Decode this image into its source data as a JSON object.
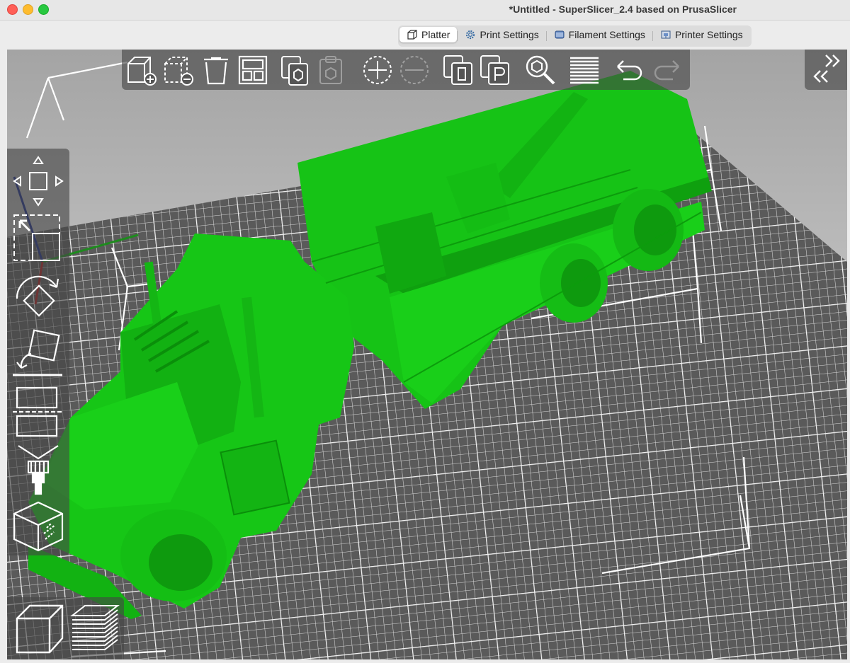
{
  "window": {
    "title": "*Untitled - SuperSlicer_2.4  based on PrusaSlicer"
  },
  "tabs": [
    {
      "label": "Platter",
      "icon": "platter-icon",
      "active": true
    },
    {
      "label": "Print Settings",
      "icon": "gear-icon",
      "active": false
    },
    {
      "label": "Filament Settings",
      "icon": "filament-spool-icon",
      "active": false
    },
    {
      "label": "Printer Settings",
      "icon": "printer-icon",
      "active": false
    }
  ],
  "toolbar": [
    {
      "name": "add-object-button",
      "icon": "cube-plus-icon",
      "enabled": true
    },
    {
      "name": "delete-object-button",
      "icon": "cube-minus-icon",
      "enabled": true
    },
    {
      "name": "delete-all-button",
      "icon": "trash-icon",
      "enabled": true
    },
    {
      "name": "arrange-button",
      "icon": "arrange-icon",
      "enabled": true
    },
    {
      "name": "copy-button",
      "icon": "copy-icon",
      "enabled": true
    },
    {
      "name": "paste-button",
      "icon": "paste-icon",
      "enabled": false
    },
    {
      "name": "add-instance-button",
      "icon": "plus-circle-icon",
      "enabled": true
    },
    {
      "name": "remove-instance-button",
      "icon": "minus-circle-icon",
      "enabled": false
    },
    {
      "name": "split-objects-button",
      "icon": "split-objects-icon",
      "enabled": true
    },
    {
      "name": "split-parts-button",
      "icon": "split-parts-icon",
      "enabled": true
    },
    {
      "name": "search-button",
      "icon": "search-icon",
      "enabled": true
    },
    {
      "name": "layers-editing-button",
      "icon": "layers-icon",
      "enabled": true
    },
    {
      "name": "undo-button",
      "icon": "undo-icon",
      "enabled": true
    },
    {
      "name": "redo-button",
      "icon": "redo-icon",
      "enabled": false
    }
  ],
  "collapse": {
    "icon": "collapse-sidebar-icon"
  },
  "left_tools": [
    {
      "name": "move-tool",
      "icon": "move-icon"
    },
    {
      "name": "scale-tool",
      "icon": "scale-icon"
    },
    {
      "name": "rotate-tool",
      "icon": "rotate-icon"
    },
    {
      "name": "place-on-face-tool",
      "icon": "place-on-face-icon"
    },
    {
      "name": "cut-tool",
      "icon": "cut-icon"
    },
    {
      "name": "paint-supports-tool",
      "icon": "paint-brush-icon"
    },
    {
      "name": "seam-painting-tool",
      "icon": "seam-cube-icon"
    }
  ],
  "view_modes": [
    {
      "name": "3d-view",
      "icon": "3d-view-cube-icon"
    },
    {
      "name": "preview-view",
      "icon": "layers-preview-icon"
    }
  ],
  "colors": {
    "model": "#17c817",
    "model_dark": "#0a8f0a",
    "bed": "#5a5a5a",
    "grid": "#d8d8d8"
  }
}
